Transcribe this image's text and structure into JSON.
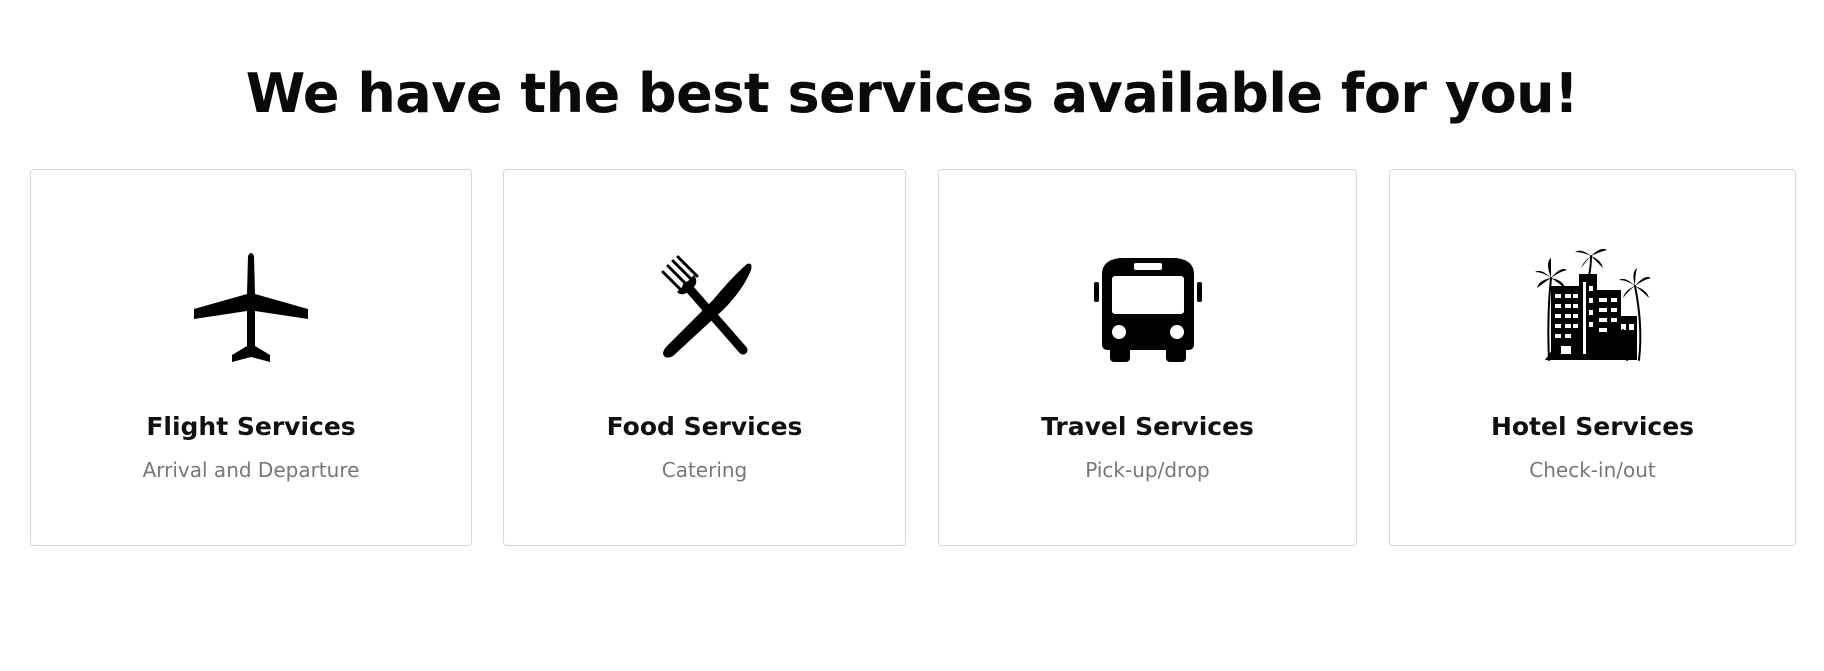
{
  "heading": "We have the best services available for you!",
  "services": [
    {
      "title": "Flight Services",
      "subtitle": "Arrival and Departure",
      "icon": "airplane-icon"
    },
    {
      "title": "Food Services",
      "subtitle": "Catering",
      "icon": "fork-and-knife-icon"
    },
    {
      "title": "Travel Services",
      "subtitle": "Pick-up/drop",
      "icon": "bus-icon"
    },
    {
      "title": "Hotel Services",
      "subtitle": "Check-in/out",
      "icon": "hotel-building-icon"
    }
  ],
  "colors": {
    "text": "#0a0a0a",
    "subtitle": "#777777",
    "card_border": "#d6d6d6",
    "background": "#ffffff"
  }
}
